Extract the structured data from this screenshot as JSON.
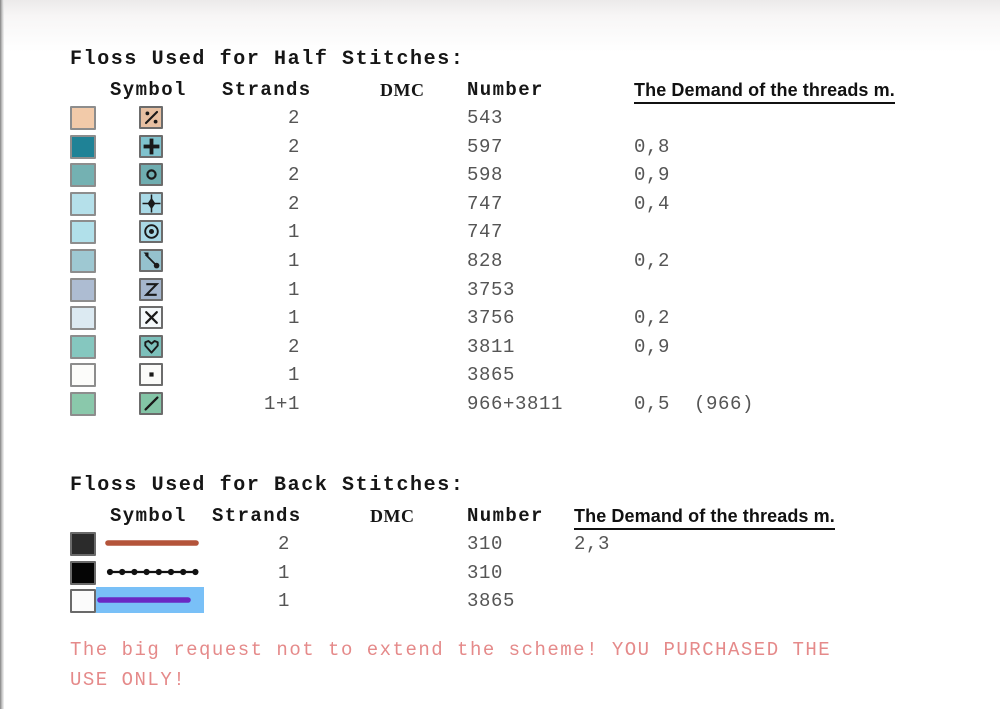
{
  "document": {
    "background_color": "#ffffff"
  },
  "half_stitches": {
    "title": "Floss Used for Half Stitches:",
    "headers": {
      "symbol": "Symbol",
      "strands": "Strands",
      "dmc": "DMC",
      "number": "Number",
      "demand": "The Demand of the threads m."
    },
    "rows": [
      {
        "swatch_color": "#f2caa9",
        "glyph": "percent",
        "glyph_bg": "#e7c0a2",
        "strands": "2",
        "number": "543",
        "demand": ""
      },
      {
        "swatch_color": "#1f8296",
        "glyph": "plus",
        "glyph_bg": "#7fc2cd",
        "strands": "2",
        "number": "597",
        "demand": "0,8"
      },
      {
        "swatch_color": "#74b1b2",
        "glyph": "circle-open",
        "glyph_bg": "#6fadb0",
        "strands": "2",
        "number": "598",
        "demand": "0,9"
      },
      {
        "swatch_color": "#b5e0ea",
        "glyph": "diamond-star",
        "glyph_bg": "#a9d9e6",
        "strands": "2",
        "number": "747",
        "demand": "0,4"
      },
      {
        "swatch_color": "#b1e0ea",
        "glyph": "target",
        "glyph_bg": "#a9d9e6",
        "strands": "1",
        "number": "747",
        "demand": ""
      },
      {
        "swatch_color": "#9ec8d2",
        "glyph": "diagonal-dots",
        "glyph_bg": "#95c2ce",
        "strands": "1",
        "number": "828",
        "demand": "0,2"
      },
      {
        "swatch_color": "#adbcd2",
        "glyph": "letter-z",
        "glyph_bg": "#a5b6cd",
        "strands": "1",
        "number": "3753",
        "demand": ""
      },
      {
        "swatch_color": "#dceaf2",
        "glyph": "letter-x",
        "glyph_bg": "#f4f8fa",
        "strands": "1",
        "number": "3756",
        "demand": "0,2"
      },
      {
        "swatch_color": "#85c7bf",
        "glyph": "heart",
        "glyph_bg": "#7cc0bb",
        "strands": "2",
        "number": "3811",
        "demand": "0,9"
      },
      {
        "swatch_color": "#fcfcfa",
        "glyph": "dot",
        "glyph_bg": "#fbfbf9",
        "strands": "1",
        "number": "3865",
        "demand": ""
      },
      {
        "swatch_color": "#8ac8ab",
        "glyph": "slash",
        "glyph_bg": "#83c4a6",
        "strands": "1+1",
        "number": "966+3811",
        "demand": "0,5  (966)"
      }
    ]
  },
  "back_stitches": {
    "title": "Floss Used for Back Stitches:",
    "headers": {
      "symbol": "Symbol",
      "strands": "Strands",
      "dmc": "DMC",
      "number": "Number",
      "demand": "The Demand of the threads m."
    },
    "rows": [
      {
        "swatch_color": "#2b2b2b",
        "line_style": "solid",
        "line_color": "#b4543a",
        "selected": false,
        "strands": "2",
        "number": "310",
        "demand": "2,3"
      },
      {
        "swatch_color": "#050505",
        "line_style": "beaded",
        "line_color": "#111111",
        "selected": false,
        "strands": "1",
        "number": "310",
        "demand": ""
      },
      {
        "swatch_color": "#fbfbfb",
        "line_style": "solid",
        "line_color": "#6a28c4",
        "selected": true,
        "selection_color": "#79c0f7",
        "strands": "1",
        "number": "3865",
        "demand": ""
      }
    ]
  },
  "footer": {
    "line1": "The big request not to extend the scheme! YOU PURCHASED THE",
    "line2": "USE ONLY!",
    "color": "#e58a8a"
  }
}
